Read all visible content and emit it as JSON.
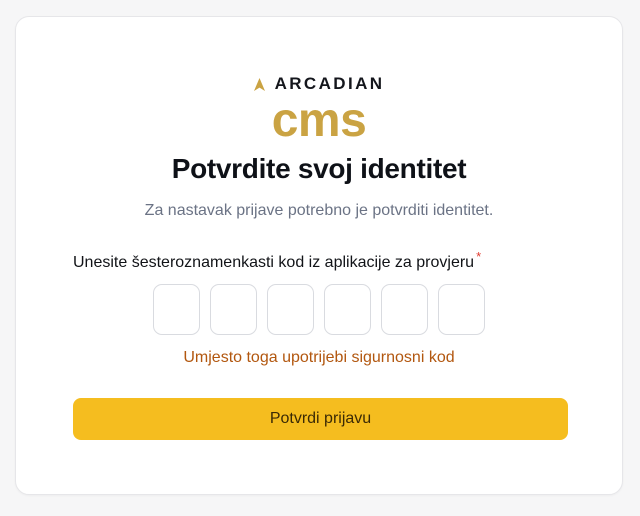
{
  "brand": {
    "name": "ARCADIAN",
    "product": "cms",
    "icon": "arrow-up-icon",
    "accent_color": "#caa343"
  },
  "auth": {
    "title": "Potvrdite svoj identitet",
    "subtitle": "Za nastavak prijave potrebno je potvrditi identitet.",
    "code_label": "Unesite šesteroznamenkasti kod iz aplikacije za provjeru",
    "required_marker": "*",
    "digits": [
      "",
      "",
      "",
      "",
      "",
      ""
    ],
    "alt_link": "Umjesto toga upotrijebi sigurnosni kod",
    "submit_label": "Potvrdi prijavu",
    "submit_color": "#f5bd1f",
    "link_color": "#b2570f"
  }
}
